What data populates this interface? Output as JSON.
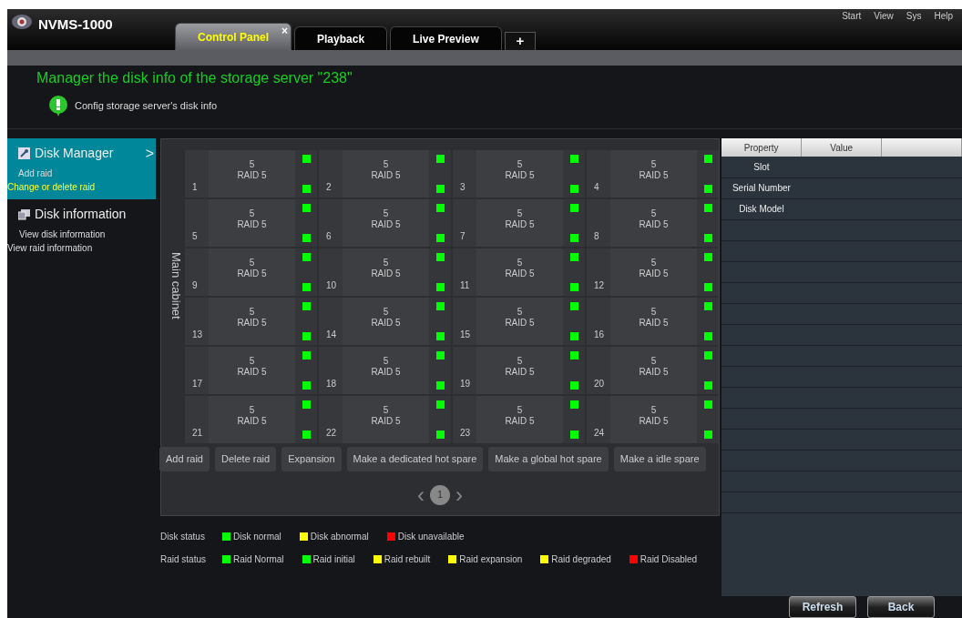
{
  "window": {
    "title": "NVMS-1000",
    "menu": [
      "Start",
      "View",
      "Sys",
      "Help"
    ]
  },
  "tabs": [
    {
      "label": "Control Panel",
      "selected": true,
      "close": "×"
    },
    {
      "label": "Playback",
      "selected": false
    },
    {
      "label": "Live Preview",
      "selected": false
    }
  ],
  "add_tab": "+",
  "header": {
    "title": "Manager the disk info of the storage server \"238\"",
    "subtitle": "Config storage server's disk info"
  },
  "sidebar": [
    {
      "title": "Disk Manager",
      "expanded": true,
      "chevron": ">",
      "links": [
        {
          "label": "Add raid",
          "selected": false
        },
        {
          "label": "Change or delete raid",
          "selected": true
        }
      ]
    },
    {
      "title": "Disk information",
      "expanded": false,
      "links": [
        {
          "label": "View disk information",
          "selected": false
        },
        {
          "label": "View raid information",
          "selected": false
        }
      ]
    }
  ],
  "cabinet_label": "Main cabinet",
  "slots": [
    {
      "number": "1",
      "count": "5",
      "raid": "RAID 5",
      "indicators": [
        {
          "color": "#00ff00"
        },
        {
          "color": "#00ff00"
        }
      ]
    },
    {
      "number": "2",
      "count": "5",
      "raid": "RAID 5",
      "indicators": [
        {
          "color": "#00ff00"
        },
        {
          "color": "#00ff00"
        }
      ]
    },
    {
      "number": "3",
      "count": "5",
      "raid": "RAID 5",
      "indicators": [
        {
          "color": "#00ff00"
        },
        {
          "color": "#00ff00"
        }
      ]
    },
    {
      "number": "4",
      "count": "5",
      "raid": "RAID 5",
      "indicators": [
        {
          "color": "#00ff00"
        },
        {
          "color": "#00ff00"
        }
      ]
    },
    {
      "number": "5",
      "count": "5",
      "raid": "RAID 5",
      "indicators": [
        {
          "color": "#00ff00"
        },
        {
          "color": "#00ff00"
        }
      ]
    },
    {
      "number": "6",
      "count": "5",
      "raid": "RAID 5",
      "indicators": [
        {
          "color": "#00ff00"
        },
        {
          "color": "#00ff00"
        }
      ]
    },
    {
      "number": "7",
      "count": "5",
      "raid": "RAID 5",
      "indicators": [
        {
          "color": "#00ff00"
        },
        {
          "color": "#00ff00"
        }
      ]
    },
    {
      "number": "8",
      "count": "5",
      "raid": "RAID 5",
      "indicators": [
        {
          "color": "#00ff00"
        },
        {
          "color": "#00ff00"
        }
      ]
    },
    {
      "number": "9",
      "count": "5",
      "raid": "RAID 5",
      "indicators": [
        {
          "color": "#00ff00"
        },
        {
          "color": "#00ff00"
        }
      ]
    },
    {
      "number": "10",
      "count": "5",
      "raid": "RAID 5",
      "indicators": [
        {
          "color": "#00ff00"
        },
        {
          "color": "#00ff00"
        }
      ]
    },
    {
      "number": "11",
      "count": "5",
      "raid": "RAID 5",
      "indicators": [
        {
          "color": "#00ff00"
        },
        {
          "color": "#00ff00"
        }
      ]
    },
    {
      "number": "12",
      "count": "5",
      "raid": "RAID 5",
      "indicators": [
        {
          "color": "#00ff00"
        },
        {
          "color": "#00ff00"
        }
      ]
    },
    {
      "number": "13",
      "count": "5",
      "raid": "RAID 5",
      "indicators": [
        {
          "color": "#00ff00"
        },
        {
          "color": "#00ff00"
        }
      ]
    },
    {
      "number": "14",
      "count": "5",
      "raid": "RAID 5",
      "indicators": [
        {
          "color": "#00ff00"
        },
        {
          "color": "#00ff00"
        }
      ]
    },
    {
      "number": "15",
      "count": "5",
      "raid": "RAID 5",
      "indicators": [
        {
          "color": "#00ff00"
        },
        {
          "color": "#00ff00"
        }
      ]
    },
    {
      "number": "16",
      "count": "5",
      "raid": "RAID 5",
      "indicators": [
        {
          "color": "#00ff00"
        },
        {
          "color": "#00ff00"
        }
      ]
    },
    {
      "number": "17",
      "count": "5",
      "raid": "RAID 5",
      "indicators": [
        {
          "color": "#00ff00"
        },
        {
          "color": "#00ff00"
        }
      ]
    },
    {
      "number": "18",
      "count": "5",
      "raid": "RAID 5",
      "indicators": [
        {
          "color": "#00ff00"
        },
        {
          "color": "#00ff00"
        }
      ]
    },
    {
      "number": "19",
      "count": "5",
      "raid": "RAID 5",
      "indicators": [
        {
          "color": "#00ff00"
        },
        {
          "color": "#00ff00"
        }
      ]
    },
    {
      "number": "20",
      "count": "5",
      "raid": "RAID 5",
      "indicators": [
        {
          "color": "#00ff00"
        },
        {
          "color": "#00ff00"
        }
      ]
    },
    {
      "number": "21",
      "count": "5",
      "raid": "RAID 5",
      "indicators": [
        {
          "color": "#00ff00"
        },
        {
          "color": "#00ff00"
        }
      ]
    },
    {
      "number": "22",
      "count": "5",
      "raid": "RAID 5",
      "indicators": [
        {
          "color": "#00ff00"
        },
        {
          "color": "#00ff00"
        }
      ]
    },
    {
      "number": "23",
      "count": "5",
      "raid": "RAID 5",
      "indicators": [
        {
          "color": "#00ff00"
        },
        {
          "color": "#00ff00"
        }
      ]
    },
    {
      "number": "24",
      "count": "5",
      "raid": "RAID 5",
      "indicators": [
        {
          "color": "#00ff00"
        },
        {
          "color": "#00ff00"
        }
      ]
    }
  ],
  "actions": [
    "Add raid",
    "Delete raid",
    "Expansion",
    "Make a dedicated hot spare",
    "Make a global hot spare",
    "Make a idle spare"
  ],
  "pagination": {
    "prev": "‹",
    "page": "1",
    "next": "›"
  },
  "legend": [
    {
      "label": "Disk status",
      "items": [
        {
          "label": "Disk normal",
          "color": "#00ff00"
        },
        {
          "label": "Disk abnormal",
          "color": "#ffff00"
        },
        {
          "label": "Disk unavailable",
          "color": "#ff0000"
        }
      ]
    },
    {
      "label": "Raid status",
      "items": [
        {
          "label": "Raid Normal",
          "color": "#00ff00"
        },
        {
          "label": "Raid initial",
          "color": "#00ff00"
        },
        {
          "label": "Raid rebuilt",
          "color": "#ffff00"
        },
        {
          "label": "Raid expansion",
          "color": "#ffff00"
        },
        {
          "label": "Raid degraded",
          "color": "#ffff00"
        },
        {
          "label": "Raid Disabled",
          "color": "#ff0000"
        }
      ]
    }
  ],
  "table": {
    "columns": [
      "Property",
      "Value"
    ],
    "rows": [
      [
        "Slot",
        ""
      ],
      [
        "Serial Number",
        ""
      ],
      [
        "Disk Model",
        ""
      ]
    ]
  },
  "buttons": [
    "Refresh",
    "Back"
  ]
}
